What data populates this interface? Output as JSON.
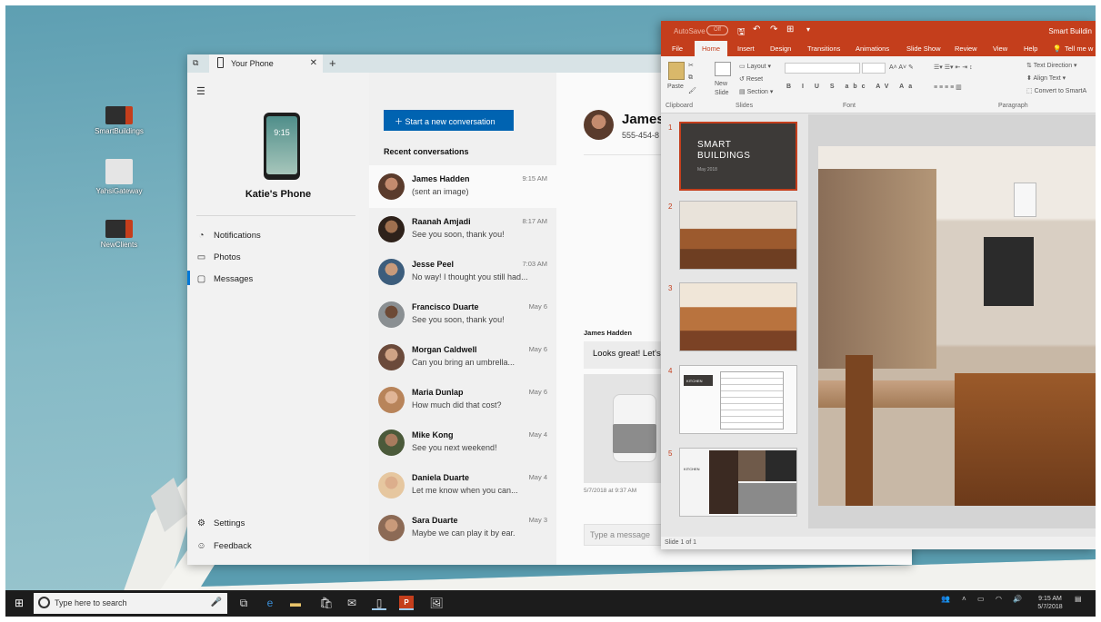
{
  "desktop": {
    "icons": [
      {
        "label": "SmartBuildings"
      },
      {
        "label": "YahsiGateway"
      },
      {
        "label": "NewClients"
      }
    ]
  },
  "your_phone": {
    "tab_title": "Your Phone",
    "phone_time": "9:15",
    "phone_name": "Katie's Phone",
    "nav": [
      {
        "label": "Notifications",
        "icon": "bell-icon"
      },
      {
        "label": "Photos",
        "icon": "photos-icon"
      },
      {
        "label": "Messages",
        "icon": "messages-icon"
      }
    ],
    "bottom_nav": [
      {
        "label": "Settings",
        "icon": "gear-icon"
      },
      {
        "label": "Feedback",
        "icon": "feedback-icon"
      }
    ],
    "new_conversation_label": "Start a new conversation",
    "recent_heading": "Recent conversations",
    "conversations": [
      {
        "name": "James Hadden",
        "preview": "(sent an image)",
        "time": "9:15 AM"
      },
      {
        "name": "Raanah Amjadi",
        "preview": "See you soon, thank you!",
        "time": "8:17 AM"
      },
      {
        "name": "Jesse Peel",
        "preview": "No way! I thought you still had...",
        "time": "7:03 AM"
      },
      {
        "name": "Francisco Duarte",
        "preview": "See you soon, thank you!",
        "time": "May 6"
      },
      {
        "name": "Morgan Caldwell",
        "preview": "Can you bring an umbrella...",
        "time": "May 6"
      },
      {
        "name": "Maria Dunlap",
        "preview": "How much did that cost?",
        "time": "May 6"
      },
      {
        "name": "Mike Kong",
        "preview": "See you next weekend!",
        "time": "May 4"
      },
      {
        "name": "Daniela Duarte",
        "preview": "Let me know when you can...",
        "time": "May 4"
      },
      {
        "name": "Sara Duarte",
        "preview": "Maybe we can play it by ear.",
        "time": "May 3"
      }
    ],
    "chat": {
      "contact_name": "James",
      "contact_phone": "555-454-8",
      "sender_label": "James Hadden",
      "message": "Looks great! Let's",
      "timestamp": "5/7/2018 at 9:37 AM",
      "input_placeholder": "Type a message"
    }
  },
  "powerpoint": {
    "autosave_label": "AutoSave",
    "autosave_state": "Off",
    "title": "Smart Buildin",
    "tabs": [
      "File",
      "Home",
      "Insert",
      "Design",
      "Transitions",
      "Animations",
      "Slide Show",
      "Review",
      "View",
      "Help",
      "Tell me w"
    ],
    "active_tab": "Home",
    "ribbon": {
      "paste": "Paste",
      "new_slide": "New Slide",
      "layout": "Layout",
      "reset": "Reset",
      "section": "Section",
      "text_direction": "Text Direction",
      "align_text": "Align Text",
      "convert": "Convert to SmartA",
      "groups": [
        "Clipboard",
        "Slides",
        "Font",
        "Paragraph"
      ]
    },
    "slides": [
      {
        "num": "1",
        "title": "SMART BUILDINGS",
        "subtitle": "May 2018"
      },
      {
        "num": "2"
      },
      {
        "num": "3"
      },
      {
        "num": "4",
        "caption": "KITCHEN"
      },
      {
        "num": "5",
        "caption": "KITCHEN"
      }
    ],
    "status": "Slide 1 of 1"
  },
  "taskbar": {
    "search_placeholder": "Type here to search",
    "time": "9:15 AM",
    "date": "5/7/2018"
  }
}
